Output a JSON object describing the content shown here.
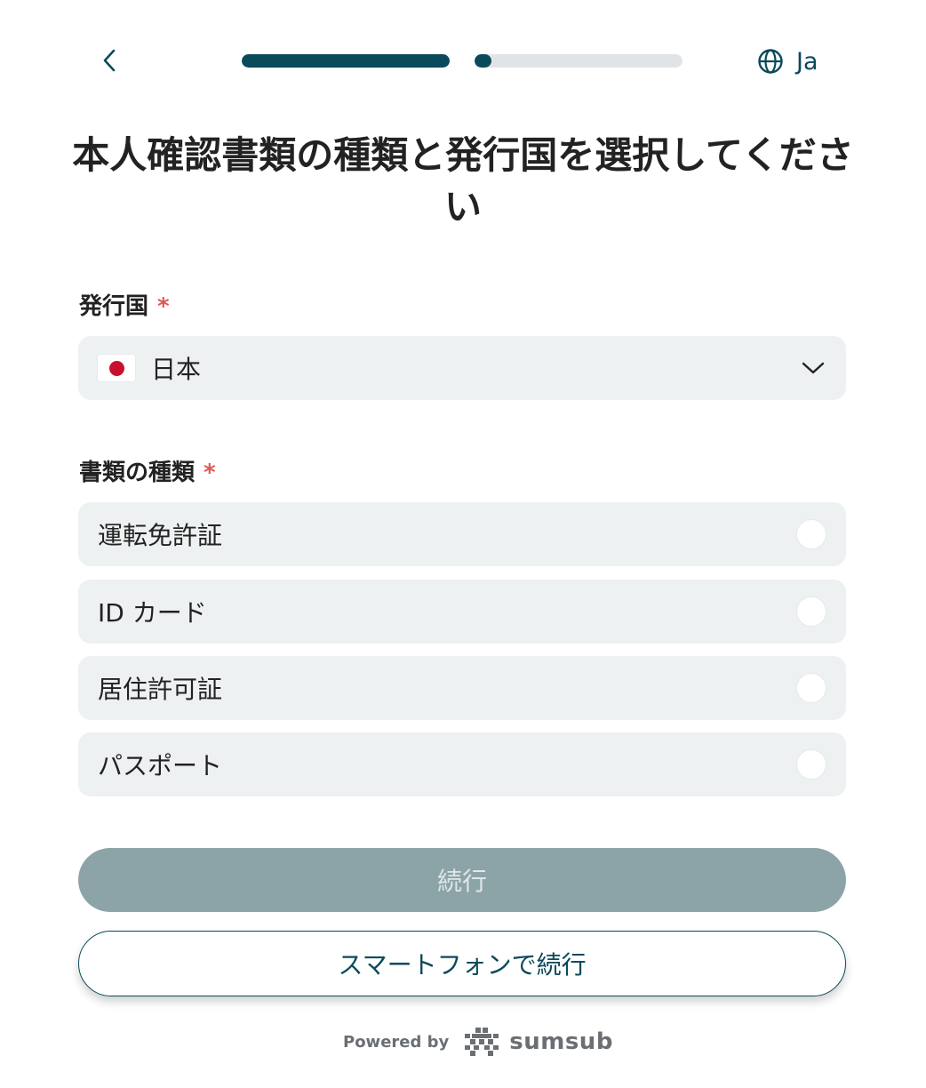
{
  "header": {
    "back_icon": "chevron-left-icon",
    "steps": [
      {
        "progress": 1.0
      },
      {
        "progress": 0.08
      }
    ],
    "language_icon": "globe-icon",
    "language_label": "Ja"
  },
  "title": "本人確認書類の種類と発行国を選択してください",
  "country_field": {
    "label": "発行国",
    "required_mark": "*",
    "selected_value": "日本",
    "flag": "japan-flag-icon"
  },
  "doc_type_field": {
    "label": "書類の種類",
    "required_mark": "*",
    "options": [
      {
        "label": "運転免許証",
        "selected": false
      },
      {
        "label": "ID カード",
        "selected": false
      },
      {
        "label": "居住許可証",
        "selected": false
      },
      {
        "label": "パスポート",
        "selected": false
      }
    ]
  },
  "buttons": {
    "continue_label": "続行",
    "continue_enabled": false,
    "phone_continue_label": "スマートフォンで続行"
  },
  "footer": {
    "powered_by": "Powered by",
    "brand": "sumsub"
  },
  "colors": {
    "accent": "#0a4a5a",
    "required": "#e05757",
    "field_bg": "#eef1f2",
    "disabled_button": "#8ca4a8"
  }
}
